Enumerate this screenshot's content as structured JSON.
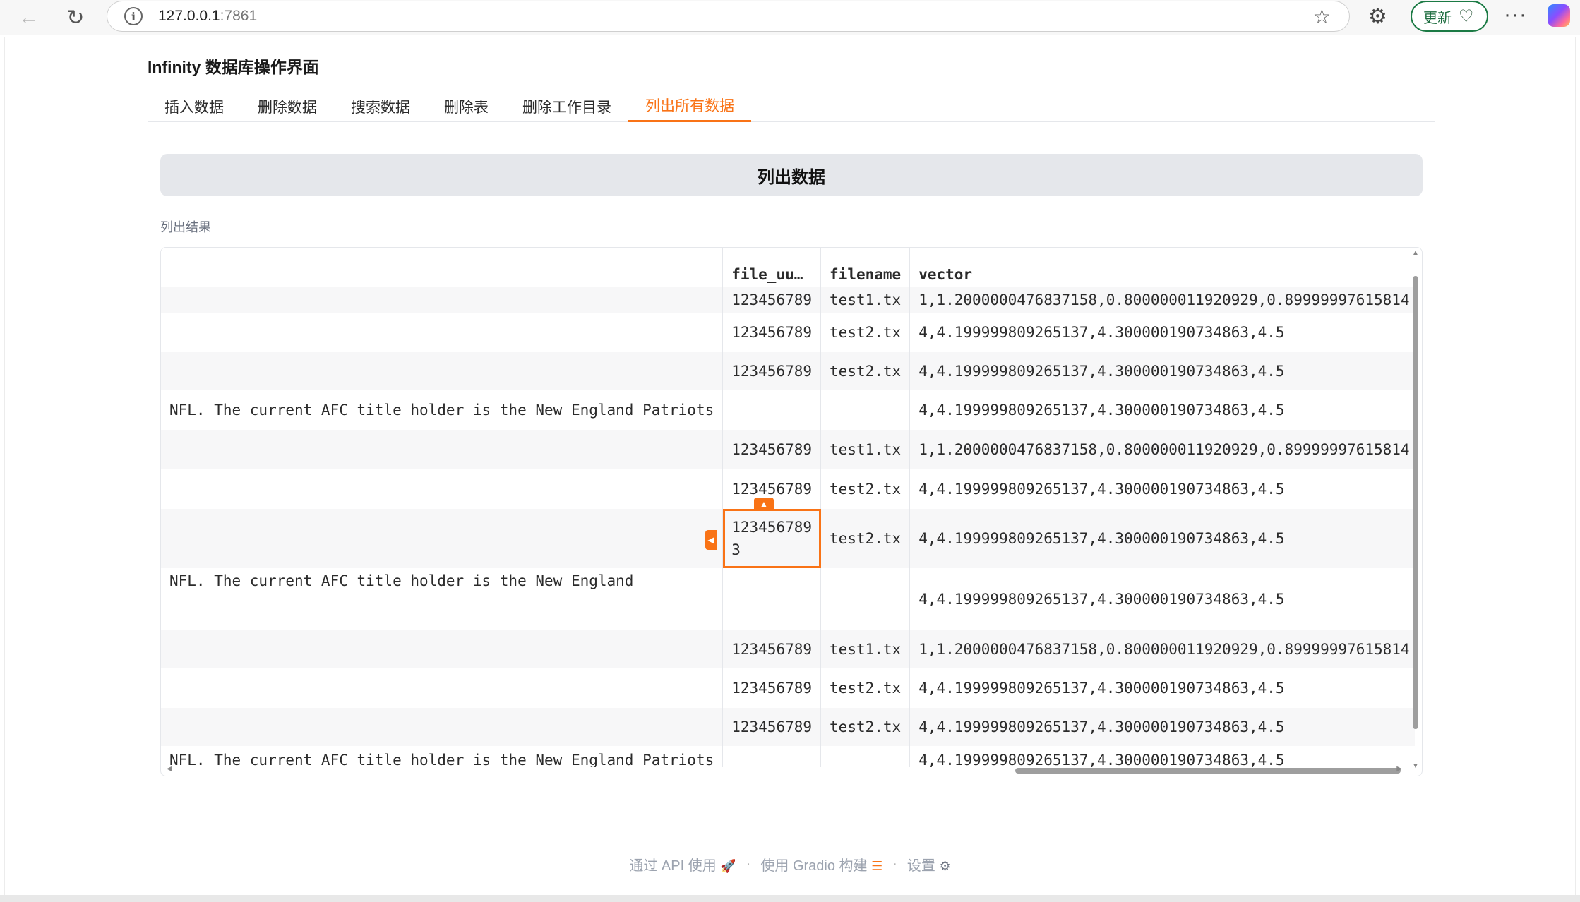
{
  "browser": {
    "url_host": "127.0.0.1",
    "url_port": ":7861",
    "update_label": "更新"
  },
  "app": {
    "title": "Infinity 数据库操作界面",
    "tabs": [
      {
        "label": "插入数据"
      },
      {
        "label": "删除数据"
      },
      {
        "label": "搜索数据"
      },
      {
        "label": "删除表"
      },
      {
        "label": "删除工作目录"
      },
      {
        "label": "列出所有数据",
        "active": true
      }
    ],
    "list_button_label": "列出数据",
    "result_label": "列出结果"
  },
  "table": {
    "headers": [
      "",
      "file_uu…",
      "filename",
      "vector"
    ],
    "rows": [
      [
        "",
        "123456789",
        "test1.tx",
        "1,1.2000000476837158,0.800000011920929,0.89999997615814"
      ],
      [
        "",
        "123456789",
        "test2.tx",
        "4,4.199999809265137,4.300000190734863,4.5"
      ],
      [
        "",
        "123456789",
        "test2.tx",
        "4,4.199999809265137,4.300000190734863,4.5"
      ],
      [
        "NFL. The current AFC title holder is the New England Patriots",
        "",
        "",
        "4,4.199999809265137,4.300000190734863,4.5"
      ],
      [
        "",
        "123456789",
        "test1.tx",
        "1,1.2000000476837158,0.800000011920929,0.89999997615814"
      ],
      [
        "",
        "123456789",
        "test2.tx",
        "4,4.199999809265137,4.300000190734863,4.5"
      ],
      [
        "",
        "1234567893",
        "test2.tx",
        "4,4.199999809265137,4.300000190734863,4.5"
      ],
      [
        "NFL. The current AFC title holder is the New England",
        "",
        "",
        "4,4.199999809265137,4.300000190734863,4.5"
      ],
      [
        "",
        "123456789",
        "test1.tx",
        "1,1.2000000476837158,0.800000011920929,0.89999997615814"
      ],
      [
        "",
        "123456789",
        "test2.tx",
        "4,4.199999809265137,4.300000190734863,4.5"
      ],
      [
        "",
        "123456789",
        "test2.tx",
        "4,4.199999809265137,4.300000190734863,4.5"
      ],
      [
        "NFL. The current AFC title holder is the New England Patriots",
        "",
        "",
        "4,4.199999809265137,4.300000190734863,4.5"
      ]
    ],
    "selected_cell": {
      "row": 6,
      "col": 1
    }
  },
  "footer": {
    "api_label": "通过 API 使用",
    "api_icon": "rocket-icon",
    "gradio_label": "使用 Gradio 构建",
    "gradio_icon": "gradio-logo-icon",
    "settings_label": "设置",
    "settings_icon": "gear-icon",
    "separator": "·"
  },
  "colors": {
    "accent": "#f97316",
    "button_bg": "#e5e7eb",
    "update_border": "#1b7a44"
  }
}
